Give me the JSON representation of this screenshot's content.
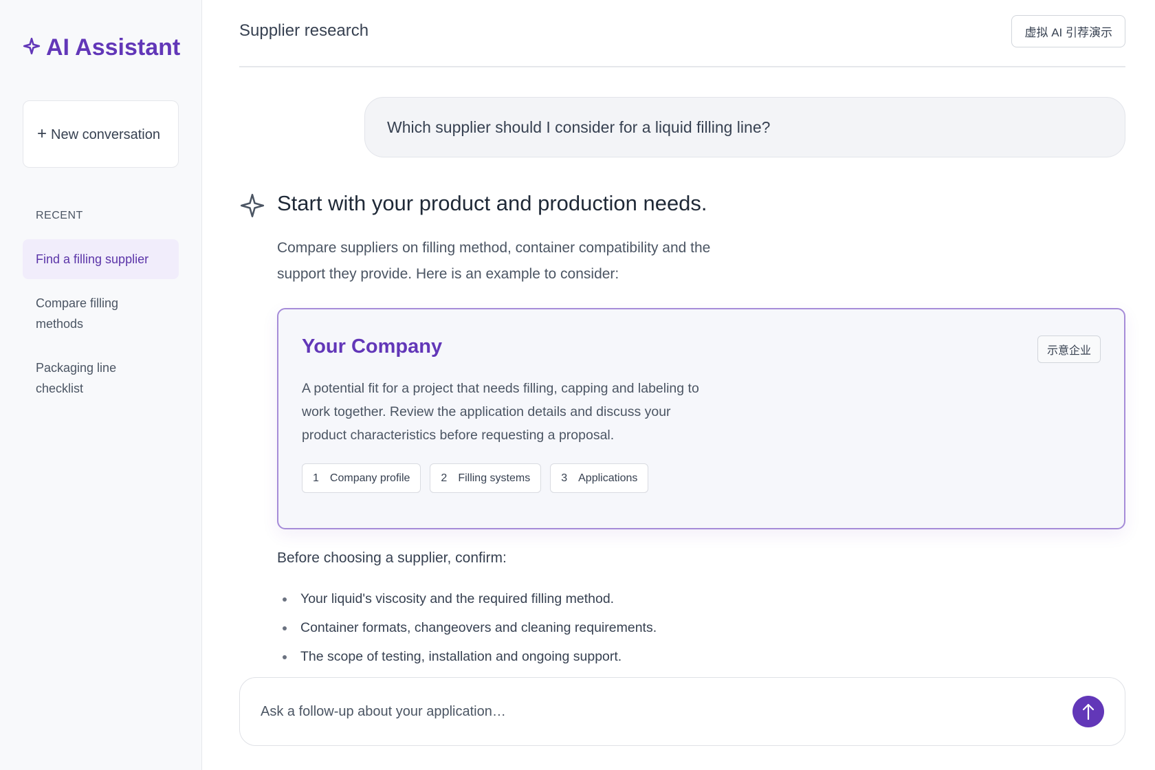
{
  "sidebar": {
    "brand": "AI Assistant",
    "new_conversation": "New conversation",
    "recent_label": "RECENT",
    "recent_items": [
      {
        "label": "Find a filling supplier"
      },
      {
        "label": "Compare filling methods"
      },
      {
        "label": "Packaging line checklist"
      }
    ]
  },
  "header": {
    "title": "Supplier research",
    "demo_badge": "虚拟 AI 引荐演示"
  },
  "conversation": {
    "user_message": "Which supplier should I consider for a liquid filling line?",
    "ai_heading": "Start with your product and production needs.",
    "ai_intro": "Compare suppliers on filling method, container compatibility and the support they provide. Here is an example to consider:",
    "card": {
      "title": "Your Company",
      "tag": "示意企业",
      "description": "A potential fit for a project that needs filling, capping and labeling to work together. Review the application details and discuss your product characteristics before requesting a proposal.",
      "chips": [
        {
          "num": "1",
          "label": "Company profile"
        },
        {
          "num": "2",
          "label": "Filling systems"
        },
        {
          "num": "3",
          "label": "Applications"
        }
      ]
    },
    "confirm_label": "Before choosing a supplier, confirm:",
    "checklist": [
      "Your liquid's viscosity and the required filling method.",
      "Container formats, changeovers and cleaning requirements.",
      "The scope of testing, installation and ongoing support."
    ]
  },
  "composer": {
    "placeholder": "Ask a follow-up about your application…"
  },
  "colors": {
    "accent": "#6237b8",
    "active_item_bg": "#f1edfb",
    "card_border": "#a58bd8"
  },
  "icons": {
    "brand": "sparkle-icon",
    "ai": "sparkle-outline-icon",
    "send": "arrow-up-icon",
    "new": "plus-icon"
  }
}
